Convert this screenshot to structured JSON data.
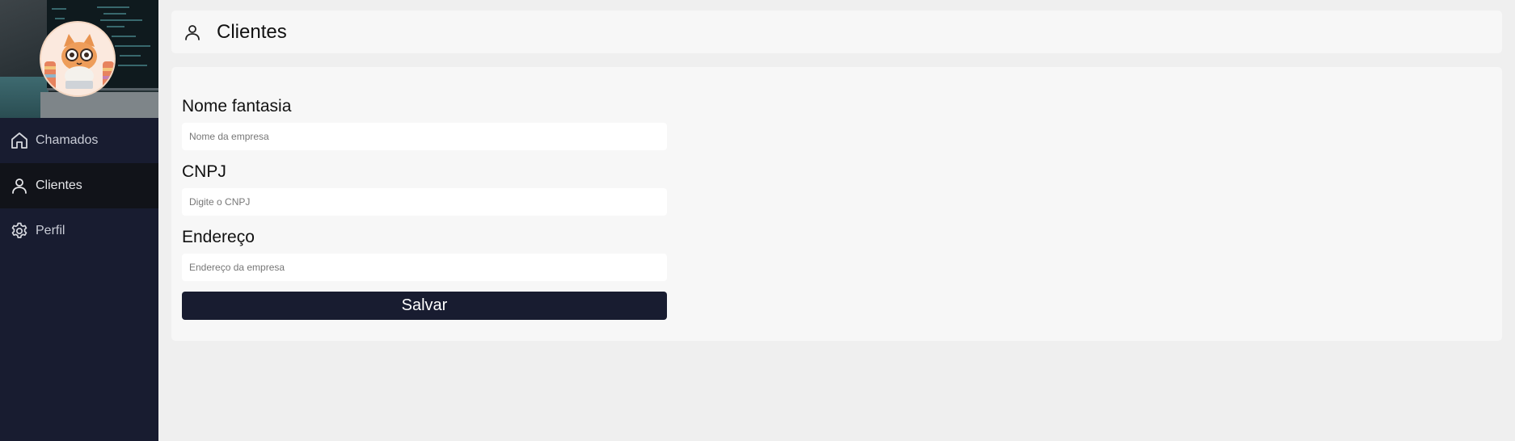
{
  "sidebar": {
    "items": [
      {
        "label": "Chamados",
        "icon": "home-icon"
      },
      {
        "label": "Clientes",
        "icon": "user-icon",
        "active": true
      },
      {
        "label": "Perfil",
        "icon": "gear-icon"
      }
    ]
  },
  "header": {
    "title": "Clientes",
    "icon": "user-icon"
  },
  "form": {
    "nome_fantasia": {
      "label": "Nome fantasia",
      "placeholder": "Nome da empresa",
      "value": ""
    },
    "cnpj": {
      "label": "CNPJ",
      "placeholder": "Digite o CNPJ",
      "value": ""
    },
    "endereco": {
      "label": "Endereço",
      "placeholder": "Endereço da empresa",
      "value": ""
    },
    "submit_label": "Salvar"
  },
  "colors": {
    "sidebar_bg": "#181c30",
    "active_item_bg": "#111319",
    "page_bg": "#efefef",
    "card_bg": "#f7f7f7",
    "button_bg": "#181c30"
  }
}
